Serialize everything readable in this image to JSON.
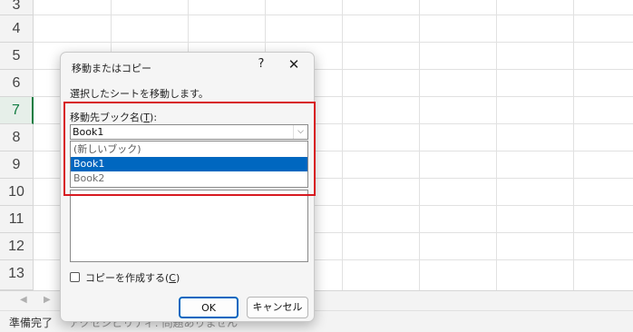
{
  "sheet": {
    "row_numbers": [
      "3",
      "4",
      "5",
      "6",
      "7",
      "8",
      "9",
      "10",
      "11",
      "12",
      "13"
    ],
    "active_row": "7"
  },
  "status_bar": {
    "ready_text": "準備完了",
    "accessibility_text": "アクセシビリティ: 問題ありません"
  },
  "dialog": {
    "title": "移動またはコピー",
    "help_label": "?",
    "close_label": "✕",
    "message": "選択したシートを移動します。",
    "destination_label_prefix": "移動先ブック名(",
    "destination_label_key": "T",
    "destination_label_suffix": "):",
    "destination_value": "Book1",
    "dropdown_options": [
      "(新しいブック)",
      "Book1",
      "Book2"
    ],
    "selected_option": "Book1",
    "copy_checkbox_prefix": "コピーを作成する(",
    "copy_checkbox_key": "C",
    "copy_checkbox_suffix": ")",
    "copy_checked": false,
    "ok_label": "OK",
    "cancel_label": "キャンセル"
  },
  "colors": {
    "selection": "#0067c0",
    "highlight_frame": "#d71920",
    "active_row": "#107c41"
  }
}
